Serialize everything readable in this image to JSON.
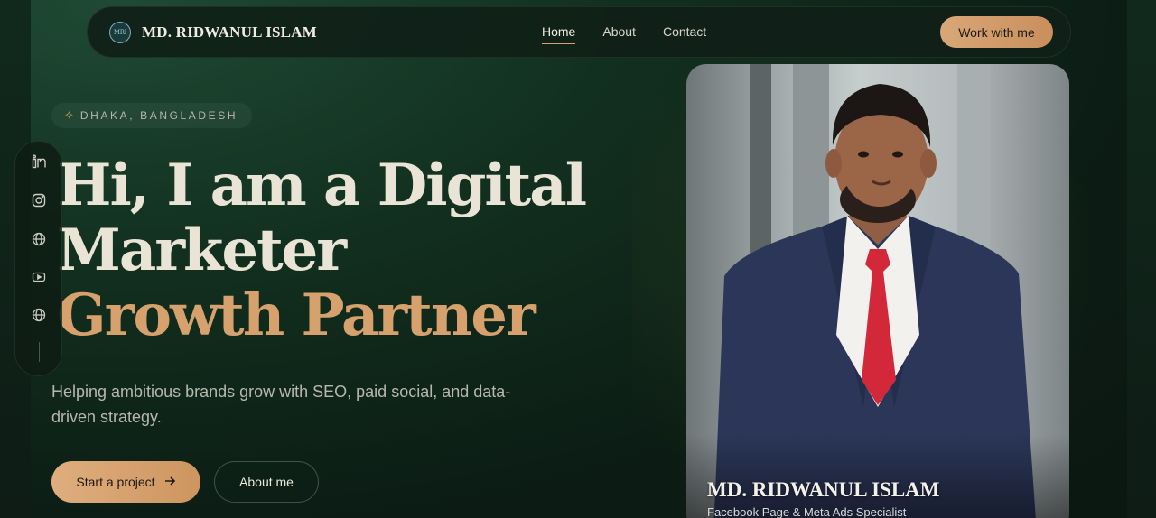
{
  "nav": {
    "logo_text": "MRI",
    "brand": "MD. RIDWANUL ISLAM",
    "links": [
      {
        "label": "Home",
        "active": true
      },
      {
        "label": "About",
        "active": false
      },
      {
        "label": "Contact",
        "active": false
      }
    ],
    "cta_label": "Work with me"
  },
  "hero": {
    "location": "DHAKA, BANGLADESH",
    "location_icon": "sparkle-icon",
    "headline_line1": "Hi, I am a Digital",
    "headline_line2": "Marketer",
    "headline_line3": "Growth Partner",
    "subtitle": "Helping ambitious brands grow with SEO, paid social, and data-driven strategy.",
    "primary_button": "Start a project",
    "primary_button_icon": "arrow-right-icon",
    "secondary_button": "About me"
  },
  "social": [
    {
      "name": "linkedin-icon"
    },
    {
      "name": "instagram-icon"
    },
    {
      "name": "globe-icon"
    },
    {
      "name": "youtube-icon"
    },
    {
      "name": "globe-icon"
    }
  ],
  "profile_card": {
    "name": "MD. RIDWANUL ISLAM",
    "role": "Facebook Page & Meta Ads Specialist"
  },
  "colors": {
    "accent": "#d6a16c",
    "background": "#0c1d15",
    "text": "#e9e4d6"
  }
}
